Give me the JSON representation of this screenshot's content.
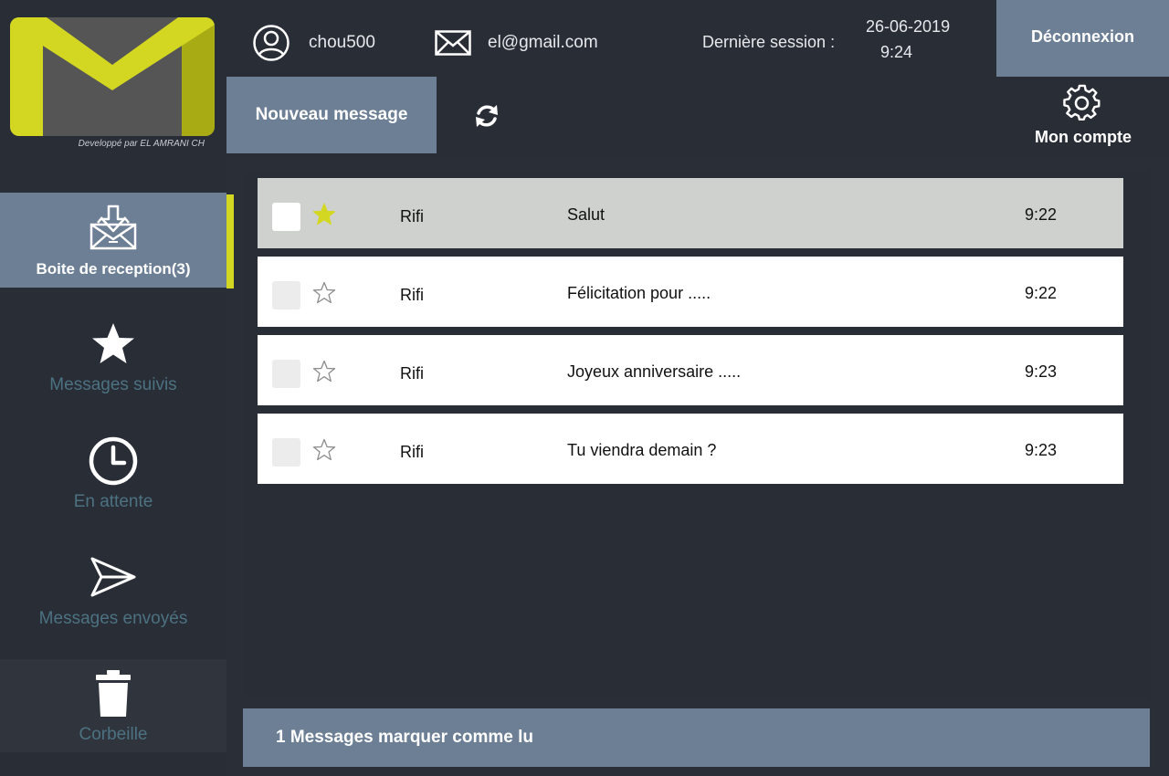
{
  "brand": {
    "credit": "Developpé par EL AMRANI CH",
    "logo_color": "#d4d722",
    "logo_shadow_color": "#a9ab15"
  },
  "header": {
    "username": "chou500",
    "email": "el@gmail.com",
    "last_session_label": "Dernière session :",
    "last_session_date": "26-06-2019",
    "last_session_time": "9:24",
    "logout_label": "Déconnexion",
    "user_icon": "user-circle-icon",
    "mail_icon": "envelope-icon"
  },
  "toolbar": {
    "new_message_label": "Nouveau message",
    "refresh_icon": "refresh-icon",
    "account_label": "Mon compte",
    "account_icon": "gear-icon"
  },
  "sidebar": {
    "items": [
      {
        "label": "Boite de reception(3)",
        "icon": "inbox-download-icon",
        "active": true
      },
      {
        "label": "Messages suivis",
        "icon": "star-icon",
        "active": false
      },
      {
        "label": "En attente",
        "icon": "clock-icon",
        "active": false
      },
      {
        "label": "Messages envoyés",
        "icon": "send-icon",
        "active": false
      },
      {
        "label": "Corbeille",
        "icon": "trash-icon",
        "active": false
      }
    ]
  },
  "messages": [
    {
      "sender": "Rifi",
      "subject": "Salut",
      "time": "9:22",
      "starred": true,
      "selected": true
    },
    {
      "sender": "Rifi",
      "subject": "Félicitation pour .....",
      "time": "9:22",
      "starred": false,
      "selected": false
    },
    {
      "sender": "Rifi",
      "subject": "Joyeux anniversaire .....",
      "time": "9:23",
      "starred": false,
      "selected": false
    },
    {
      "sender": "Rifi",
      "subject": "Tu viendra demain ?",
      "time": "9:23",
      "starred": false,
      "selected": false
    }
  ],
  "status": {
    "text": "1 Messages marquer comme lu"
  },
  "colors": {
    "background": "#2a2e37",
    "accent_panel": "#6c7f95",
    "star_active": "#d4d722",
    "inactive_label": "#4c7282"
  }
}
